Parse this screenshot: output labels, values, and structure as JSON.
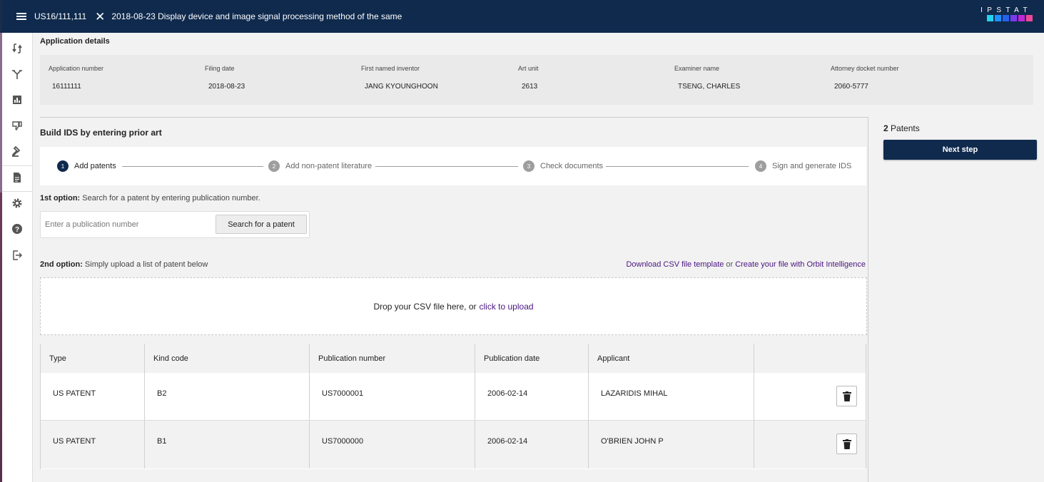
{
  "header": {
    "application_id": "US16/111,111",
    "title": "2018-08-23 Display device and image signal processing method of the same",
    "logo_text": "IPSTAT",
    "logo_colors": [
      "#22d3ee",
      "#1e90ff",
      "#2563eb",
      "#7c3aed",
      "#c026d3",
      "#ec4899"
    ]
  },
  "sidebar": {
    "icons": [
      "compare-icon",
      "branch-icon",
      "chart-icon",
      "thumb-down-icon",
      "gavel-icon",
      "document-icon",
      "gear-icon",
      "help-icon",
      "logout-icon"
    ]
  },
  "details": {
    "title": "Application details",
    "fields": [
      {
        "label": "Application number",
        "value": "16111111"
      },
      {
        "label": "Filing date",
        "value": "2018-08-23"
      },
      {
        "label": "First named inventor",
        "value": "JANG KYOUNGHOON"
      },
      {
        "label": "Art unit",
        "value": "2613"
      },
      {
        "label": "Examiner name",
        "value": "TSENG, CHARLES"
      },
      {
        "label": "Attorney docket number",
        "value": "2060-5777"
      }
    ]
  },
  "build": {
    "title": "Build IDS by entering prior art",
    "steps": [
      {
        "num": "1",
        "label": "Add patents",
        "active": true
      },
      {
        "num": "2",
        "label": "Add non-patent literature",
        "active": false
      },
      {
        "num": "3",
        "label": "Check documents",
        "active": false
      },
      {
        "num": "4",
        "label": "Sign and generate IDS",
        "active": false
      }
    ],
    "option1": {
      "bold": "1st option:",
      "text": " Search for a patent by entering publication number."
    },
    "search": {
      "placeholder": "Enter a publication number",
      "value": "",
      "button": "Search for a patent"
    },
    "option2": {
      "bold": "2nd option:",
      "text": " Simply upload a list of patent below"
    },
    "links": {
      "download": "Download CSV file template",
      "or": "or",
      "orbit": "Create your file with Orbit Intelligence"
    },
    "dropzone": {
      "text": "Drop your CSV file here, or",
      "link": "click to upload"
    }
  },
  "table": {
    "columns": [
      "Type",
      "Kind code",
      "Publication number",
      "Publication date",
      "Applicant",
      ""
    ],
    "rows": [
      [
        "US PATENT",
        "B2",
        "US7000001",
        "2006-02-14",
        "LAZARIDIS MIHAL"
      ],
      [
        "US PATENT",
        "B1",
        "US7000000",
        "2006-02-14",
        "O'BRIEN JOHN P"
      ]
    ]
  },
  "panel": {
    "count": "2",
    "count_label": " Patents",
    "next_button": "Next step"
  }
}
